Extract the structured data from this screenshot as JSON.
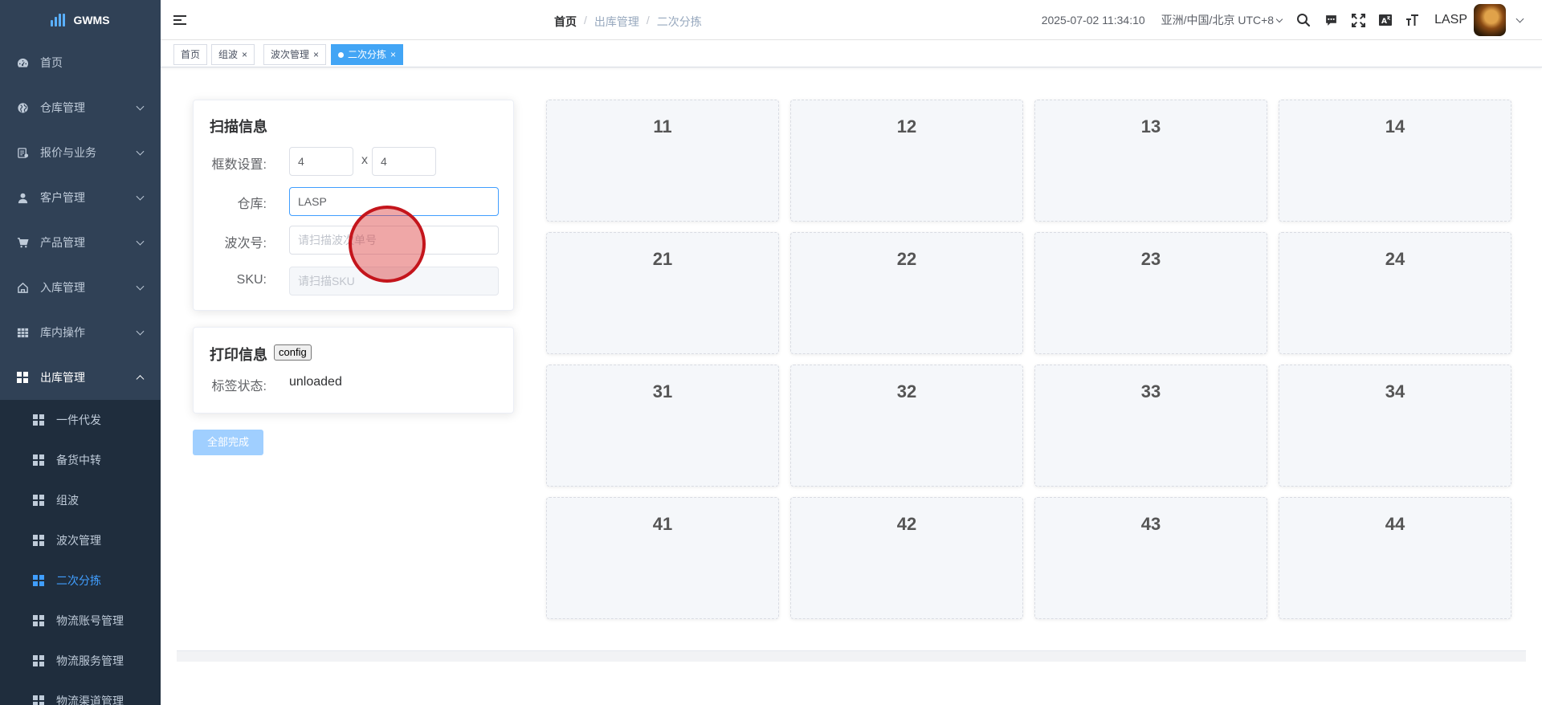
{
  "app": {
    "name": "GWMS"
  },
  "sidebar": {
    "items": [
      {
        "label": "首页",
        "icon": "dashboard-icon"
      },
      {
        "label": "仓库管理",
        "icon": "globe-icon"
      },
      {
        "label": "报价与业务",
        "icon": "document-icon"
      },
      {
        "label": "客户管理",
        "icon": "user-icon"
      },
      {
        "label": "产品管理",
        "icon": "cart-icon"
      },
      {
        "label": "入库管理",
        "icon": "home-icon"
      },
      {
        "label": "库内操作",
        "icon": "table-icon"
      },
      {
        "label": "出库管理",
        "icon": "grid-icon"
      }
    ],
    "submenu": [
      {
        "label": "一件代发"
      },
      {
        "label": "备货中转"
      },
      {
        "label": "组波"
      },
      {
        "label": "波次管理"
      },
      {
        "label": "二次分拣"
      },
      {
        "label": "物流账号管理"
      },
      {
        "label": "物流服务管理"
      },
      {
        "label": "物流渠道管理"
      }
    ]
  },
  "header": {
    "breadcrumb": [
      "首页",
      "出库管理",
      "二次分拣"
    ],
    "datetime": "2025-07-02 11:34:10",
    "timezone": "亚洲/中国/北京 UTC+8",
    "username": "LASP"
  },
  "tags": [
    {
      "label": "首页"
    },
    {
      "label": "组波",
      "close": "×"
    },
    {
      "label": "波次管理",
      "close": "×"
    },
    {
      "label": "二次分拣",
      "close": "×"
    }
  ],
  "scan_card": {
    "title": "扫描信息",
    "frame_label": "框数设置:",
    "frame_rows": "4",
    "frame_x": "x",
    "frame_cols": "4",
    "warehouse_label": "仓库:",
    "warehouse_value": "LASP",
    "wave_label": "波次号:",
    "wave_placeholder": "请扫描波次单号",
    "sku_label": "SKU:",
    "sku_placeholder": "请扫描SKU"
  },
  "print_card": {
    "title": "打印信息",
    "config_label": "config",
    "status_label": "标签状态:",
    "status_value": "unloaded"
  },
  "complete_button": "全部完成",
  "bins": [
    "11",
    "12",
    "13",
    "14",
    "21",
    "22",
    "23",
    "24",
    "31",
    "32",
    "33",
    "34",
    "41",
    "42",
    "43",
    "44"
  ],
  "colors": {
    "sidebar_bg": "#304156",
    "submenu_bg": "#1f2d3d",
    "accent": "#409eff",
    "active_tag": "#42a5f5"
  }
}
